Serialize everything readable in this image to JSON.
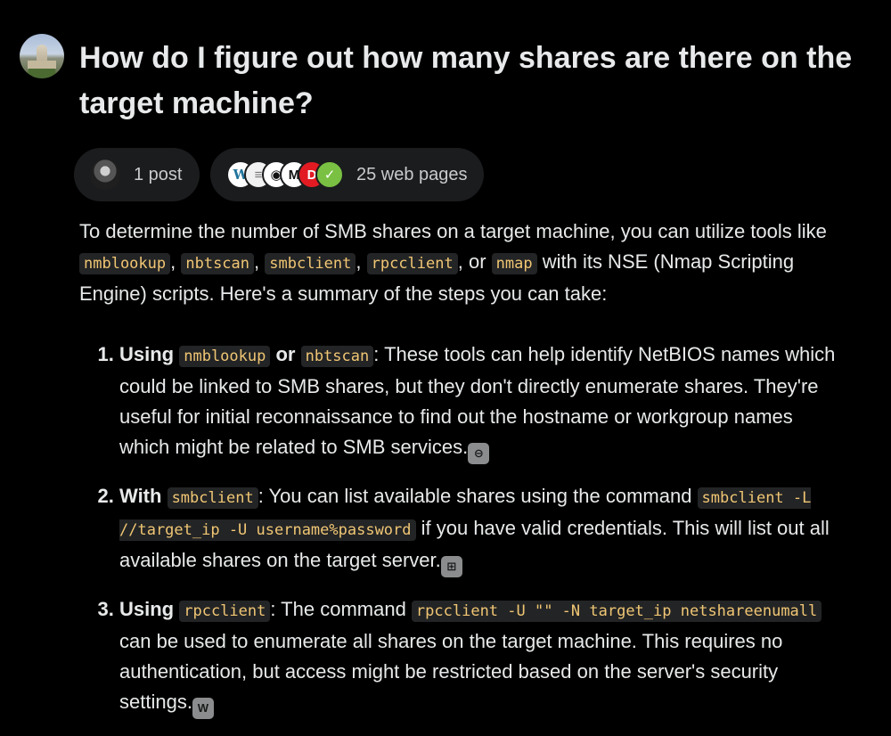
{
  "question": "How do I figure out how many shares are there on the target machine?",
  "sources": {
    "posts_label": "1 post",
    "web_label": "25 web pages",
    "web_icons": [
      "wordpress-icon",
      "document-icon",
      "eye-icon",
      "m-logo-icon",
      "d-logo-icon",
      "g-logo-icon"
    ]
  },
  "answer": {
    "intro": {
      "t1": "To determine the number of SMB shares on a target machine, you can utilize tools like ",
      "c1": "nmblookup",
      "t2": ", ",
      "c2": "nbtscan",
      "t3": ", ",
      "c3": "smbclient",
      "t4": ", ",
      "c4": "rpcclient",
      "t5": ", or ",
      "c5": "nmap",
      "t6": " with its NSE (Nmap Scripting Engine) scripts. Here's a summary of the steps you can take:"
    },
    "steps": [
      {
        "bold": "Using ",
        "code1": "nmblookup",
        "bold2": " or ",
        "code2": "nbtscan",
        "text": ": These tools can help identify NetBIOS names which could be linked to SMB shares, but they don't directly enumerate shares. They're useful for initial reconnaissance to find out the hostname or workgroup names which might be related to SMB services."
      },
      {
        "bold": "With ",
        "code1": "smbclient",
        "text1": ": You can list available shares using the command ",
        "code2": "smbclient -L //target_ip -U username%password",
        "text2": " if you have valid credentials. This will list out all available shares on the target server."
      },
      {
        "bold": "Using ",
        "code1": "rpcclient",
        "text1": ": The command ",
        "code2": "rpcclient -U \"\" -N target_ip netshareenumall",
        "text2": " can be used to enumerate all shares on the target machine. This requires no authentication, but access might be restricted based on the server's security settings."
      }
    ],
    "citations": [
      "link-icon",
      "windows-icon",
      "wordpress-icon"
    ]
  }
}
